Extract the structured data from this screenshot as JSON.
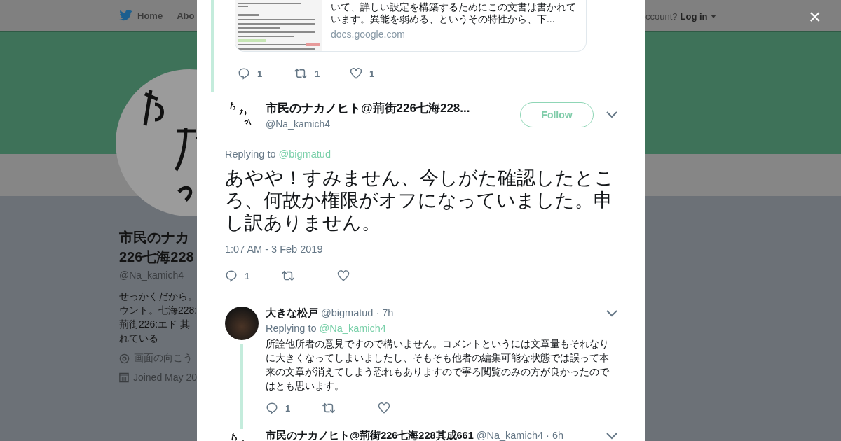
{
  "nav": {
    "items": [
      {
        "label": "Home",
        "kind": "home"
      },
      {
        "label": "Abo",
        "kind": "plain"
      }
    ],
    "account_prompt": "ccount?",
    "login": "Log in"
  },
  "profile": {
    "name_lines": [
      "市民のナカ",
      "226七海228"
    ],
    "handle": "@Na_kamich4",
    "bio_lines": [
      "せっかくだから。",
      "ウント。七海228:",
      "荊街226:エド 其",
      "れている"
    ],
    "location": "画面の向こう",
    "joined": "Joined May 20"
  },
  "modal": {
    "link_card": {
      "description": "いて、詳しい設定を構築するためにこの文書は書かれています。異能を弱める、というその特性から、下...",
      "domain": "docs.google.com"
    },
    "previous_actions": {
      "replies": "1",
      "retweets": "1",
      "likes": "1"
    },
    "tweet": {
      "name": "市民のナカノヒト@荊街226七海228...",
      "handle": "@Na_kamich4",
      "follow": "Follow",
      "replying_label": "Replying to",
      "replying_to": "@bigmatud",
      "text": "あやや！すみません、今しがた確認したところ、何故か権限がオフになっていました。申し訳ありません。",
      "time": "1:07 AM - 3 Feb 2019",
      "replies": "1"
    },
    "replies": [
      {
        "name": "大きな松戸",
        "handle": "@bigmatud",
        "age": "· 7h",
        "replying_label": "Replying to",
        "replying_to": "@Na_kamich4",
        "text": "所詮他所者の意見ですので構いません。コメントというには文章量もそれなりに大きくなってしまいましたし、そもそも他者の編集可能な状態では誤って本来の文章が消えてしまう恐れもありますので寧ろ閲覧のみの方が良かったのではとも思います。",
        "replies": "1",
        "thread": true
      },
      {
        "kind": "sketch",
        "name": "市民のナカノヒト@荊街226七海228其成661",
        "handle": "@Na_kamich4",
        "age": "· 6h",
        "thread": false
      }
    ]
  },
  "close": "×"
}
